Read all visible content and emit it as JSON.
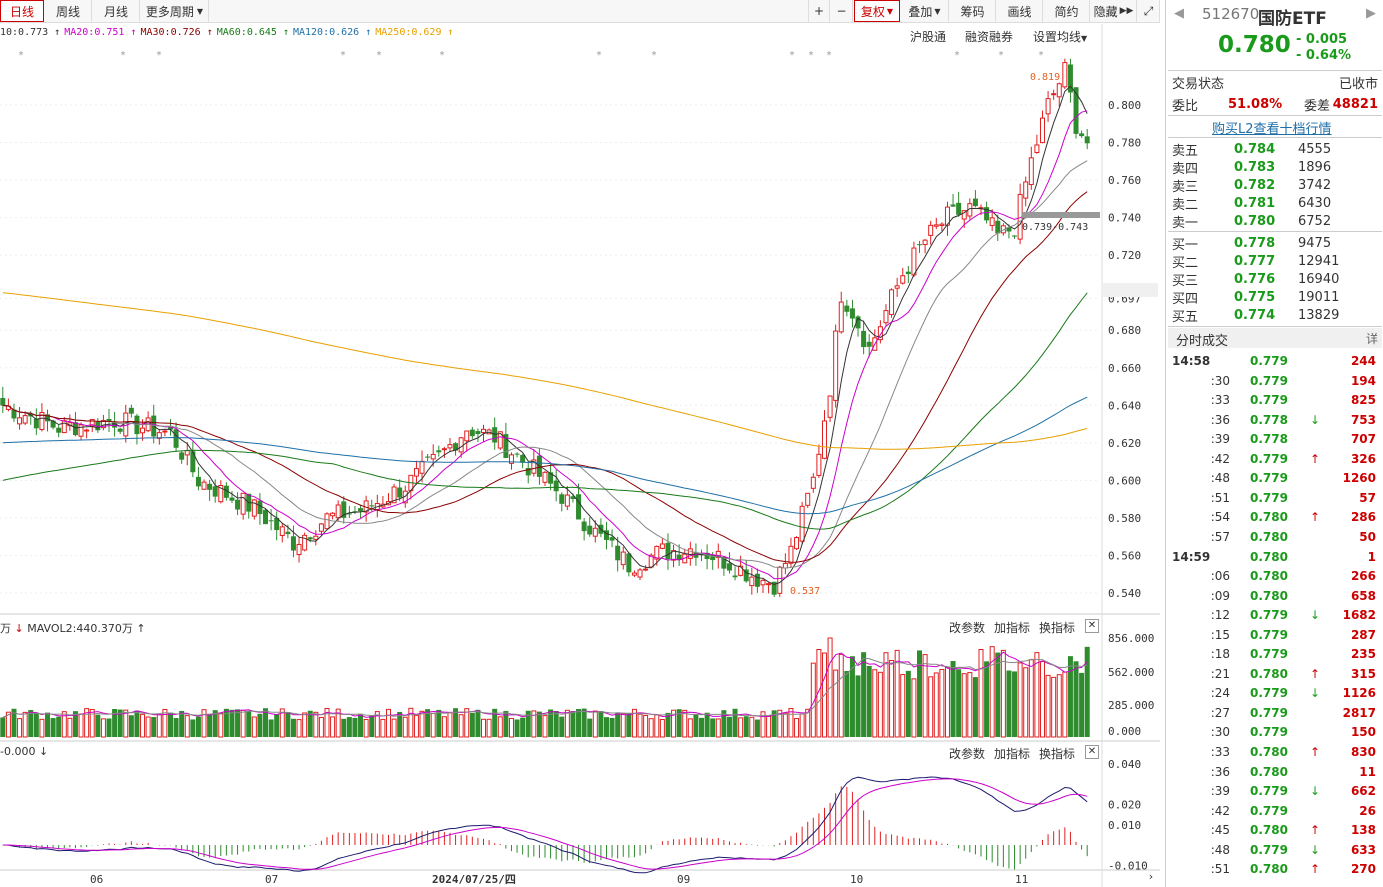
{
  "toolbar": {
    "periods": [
      "日线",
      "周线",
      "月线",
      "更多周期"
    ],
    "zoom_in": "+",
    "zoom_out": "−",
    "adjust": "复权",
    "overlay": "叠加",
    "chips": "筹码",
    "draw": "画线",
    "simple": "简约",
    "hide": "隐藏",
    "collapse_icon": "double-chevron-right"
  },
  "ma_legend": [
    {
      "label": "10:0.773",
      "color": "#333333"
    },
    {
      "label": "MA20:0.751",
      "color": "#cc00cc"
    },
    {
      "label": "MA30:0.726",
      "color": "#8b0000"
    },
    {
      "label": "MA60:0.645",
      "color": "#1a7a1a"
    },
    {
      "label": "MA120:0.626",
      "color": "#1e6fa8"
    },
    {
      "label": "MA250:0.629",
      "color": "#e8a000"
    }
  ],
  "links": {
    "hgt": "沪股通",
    "margin": "融资融券",
    "ma_settings": "设置均线"
  },
  "price_labels": [
    "0.800",
    "0.780",
    "0.760",
    "0.740",
    "0.720",
    "0.697",
    "0.680",
    "0.660",
    "0.640",
    "0.620",
    "0.600",
    "0.580",
    "0.560",
    "0.540"
  ],
  "annotations": {
    "high": "0.819",
    "low": "0.537",
    "gap": "0.739-0.743"
  },
  "volume_panel": {
    "legend_left": "万",
    "mavol": "MAVOL2:440.370万",
    "labels": [
      "856.000",
      "562.000",
      "285.000",
      "0.000"
    ],
    "actions": [
      "改参数",
      "加指标",
      "换指标"
    ]
  },
  "macd_panel": {
    "legend": "-0.000",
    "labels": [
      "0.040",
      "0.020",
      "0.010",
      "-0.010"
    ],
    "actions": [
      "改参数",
      "加指标",
      "换指标"
    ]
  },
  "x_labels": [
    "06",
    "07",
    "2024/07/25/四",
    "09",
    "10",
    "11"
  ],
  "quote": {
    "code": "512670",
    "name": "国防ETF",
    "price": "0.780",
    "change": "- 0.005",
    "change_pct": "- 0.64%",
    "status_label": "交易状态",
    "status_value": "已收市",
    "ratio_label": "委比",
    "ratio_value": "51.08%",
    "diff_label": "委差",
    "diff_value": "48821",
    "l2_link": "购买L2查看十档行情"
  },
  "asks": [
    {
      "label": "卖五",
      "price": "0.784",
      "vol": "4555"
    },
    {
      "label": "卖四",
      "price": "0.783",
      "vol": "1896"
    },
    {
      "label": "卖三",
      "price": "0.782",
      "vol": "3742"
    },
    {
      "label": "卖二",
      "price": "0.781",
      "vol": "6430"
    },
    {
      "label": "卖一",
      "price": "0.780",
      "vol": "6752"
    }
  ],
  "bids": [
    {
      "label": "买一",
      "price": "0.778",
      "vol": "9475"
    },
    {
      "label": "买二",
      "price": "0.777",
      "vol": "12941"
    },
    {
      "label": "买三",
      "price": "0.776",
      "vol": "16940"
    },
    {
      "label": "买四",
      "price": "0.775",
      "vol": "19011"
    },
    {
      "label": "买五",
      "price": "0.774",
      "vol": "13829"
    }
  ],
  "ticks_header": {
    "title": "分时成交",
    "detail": "详"
  },
  "ticks": [
    {
      "t": "14:58",
      "p": "0.779",
      "v": "244",
      "arrow": ""
    },
    {
      "t": ":30",
      "p": "0.779",
      "v": "194",
      "arrow": ""
    },
    {
      "t": ":33",
      "p": "0.779",
      "v": "825",
      "arrow": ""
    },
    {
      "t": ":36",
      "p": "0.778",
      "v": "753",
      "arrow": "down"
    },
    {
      "t": ":39",
      "p": "0.778",
      "v": "707",
      "arrow": ""
    },
    {
      "t": ":42",
      "p": "0.779",
      "v": "326",
      "arrow": "up"
    },
    {
      "t": ":48",
      "p": "0.779",
      "v": "1260",
      "arrow": ""
    },
    {
      "t": ":51",
      "p": "0.779",
      "v": "57",
      "arrow": ""
    },
    {
      "t": ":54",
      "p": "0.780",
      "v": "286",
      "arrow": "up"
    },
    {
      "t": ":57",
      "p": "0.780",
      "v": "50",
      "arrow": ""
    },
    {
      "t": "14:59",
      "p": "0.780",
      "v": "1",
      "arrow": ""
    },
    {
      "t": ":06",
      "p": "0.780",
      "v": "266",
      "arrow": ""
    },
    {
      "t": ":09",
      "p": "0.780",
      "v": "658",
      "arrow": ""
    },
    {
      "t": ":12",
      "p": "0.779",
      "v": "1682",
      "arrow": "down"
    },
    {
      "t": ":15",
      "p": "0.779",
      "v": "287",
      "arrow": ""
    },
    {
      "t": ":18",
      "p": "0.779",
      "v": "235",
      "arrow": ""
    },
    {
      "t": ":21",
      "p": "0.780",
      "v": "315",
      "arrow": "up"
    },
    {
      "t": ":24",
      "p": "0.779",
      "v": "1126",
      "arrow": "down"
    },
    {
      "t": ":27",
      "p": "0.779",
      "v": "2817",
      "arrow": ""
    },
    {
      "t": ":30",
      "p": "0.779",
      "v": "150",
      "arrow": ""
    },
    {
      "t": ":33",
      "p": "0.780",
      "v": "830",
      "arrow": "up"
    },
    {
      "t": ":36",
      "p": "0.780",
      "v": "11",
      "arrow": ""
    },
    {
      "t": ":39",
      "p": "0.779",
      "v": "662",
      "arrow": "down"
    },
    {
      "t": ":42",
      "p": "0.779",
      "v": "26",
      "arrow": ""
    },
    {
      "t": ":45",
      "p": "0.780",
      "v": "138",
      "arrow": "up"
    },
    {
      "t": ":48",
      "p": "0.779",
      "v": "633",
      "arrow": "down"
    },
    {
      "t": ":51",
      "p": "0.780",
      "v": "270",
      "arrow": "up"
    }
  ],
  "colors": {
    "up": "#e02020",
    "down": "#2e8b2e",
    "ma250": "#e8a000",
    "ma120": "#1e6fa8",
    "ma60": "#1a7a1a",
    "ma30": "#8b0000",
    "ma20": "#cc00cc",
    "ma10": "#333333"
  }
}
